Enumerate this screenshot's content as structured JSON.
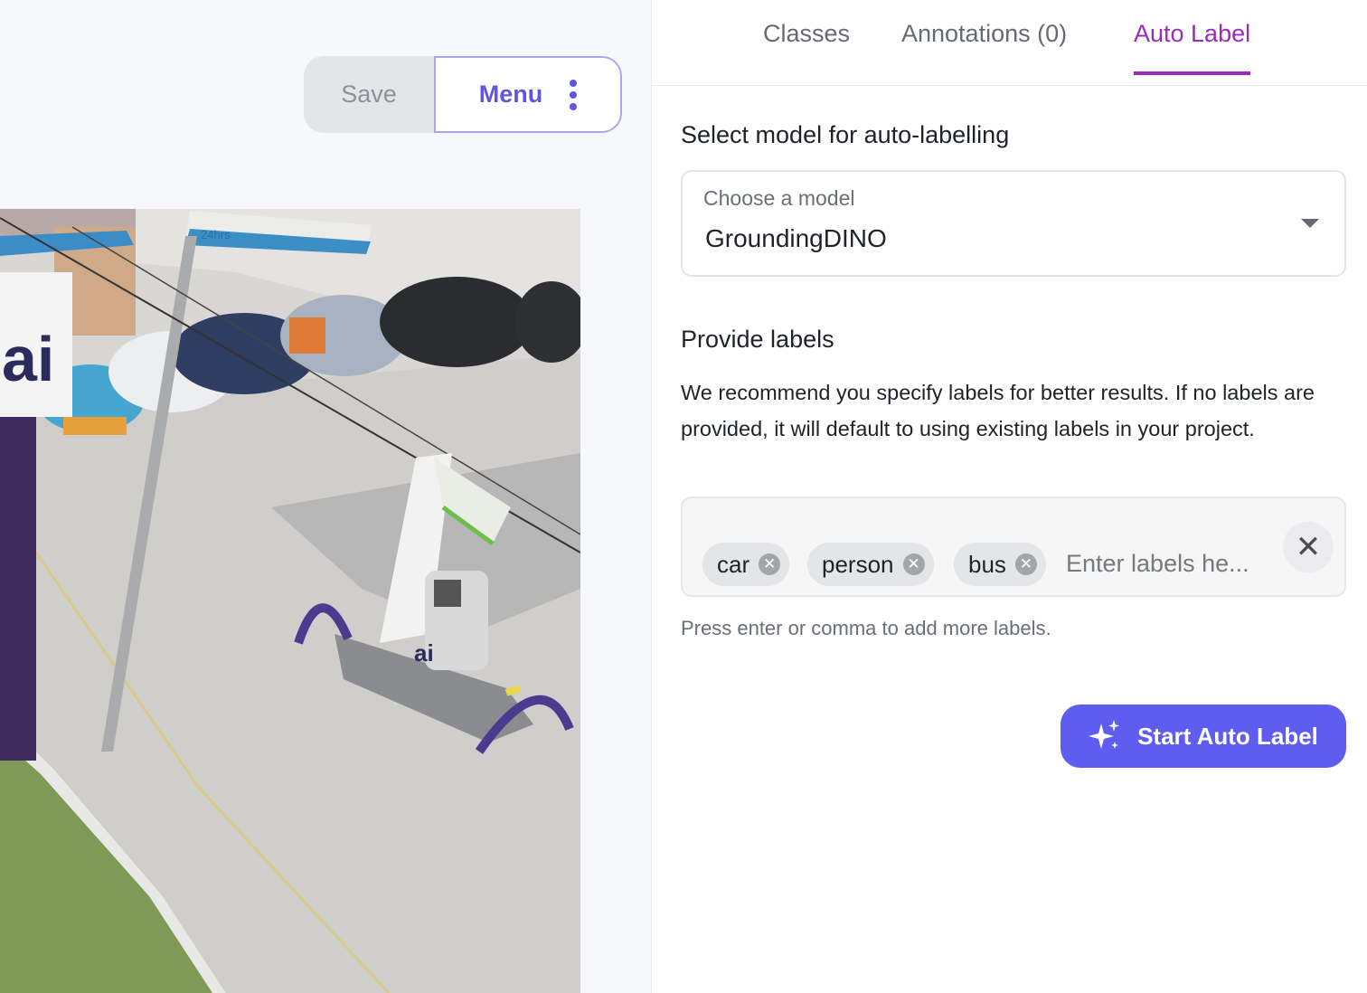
{
  "toolbar": {
    "save_label": "Save",
    "menu_label": "Menu"
  },
  "photo": {
    "sign_text": "24hrs",
    "brand_text": "ai"
  },
  "tabs": [
    {
      "label": "Classes",
      "active": false
    },
    {
      "label": "Annotations (0)",
      "active": false
    },
    {
      "label": "Auto Label",
      "active": true
    }
  ],
  "autolabel": {
    "model_section_title": "Select model for auto-labelling",
    "model_field_label": "Choose a model",
    "model_value": "GroundingDINO",
    "labels_section_title": "Provide labels",
    "description": "We recommend you specify labels for better results. If no labels are provided, it will default to using existing labels in your project.",
    "labels": [
      "car",
      "person",
      "bus"
    ],
    "input_placeholder": "Enter labels he...",
    "hint": "Press enter or comma to add more labels.",
    "start_button_label": "Start Auto Label"
  },
  "colors": {
    "accent": "#5f5cf0",
    "active_tab": "#9c2bb8",
    "menu_text": "#5f55e3"
  }
}
